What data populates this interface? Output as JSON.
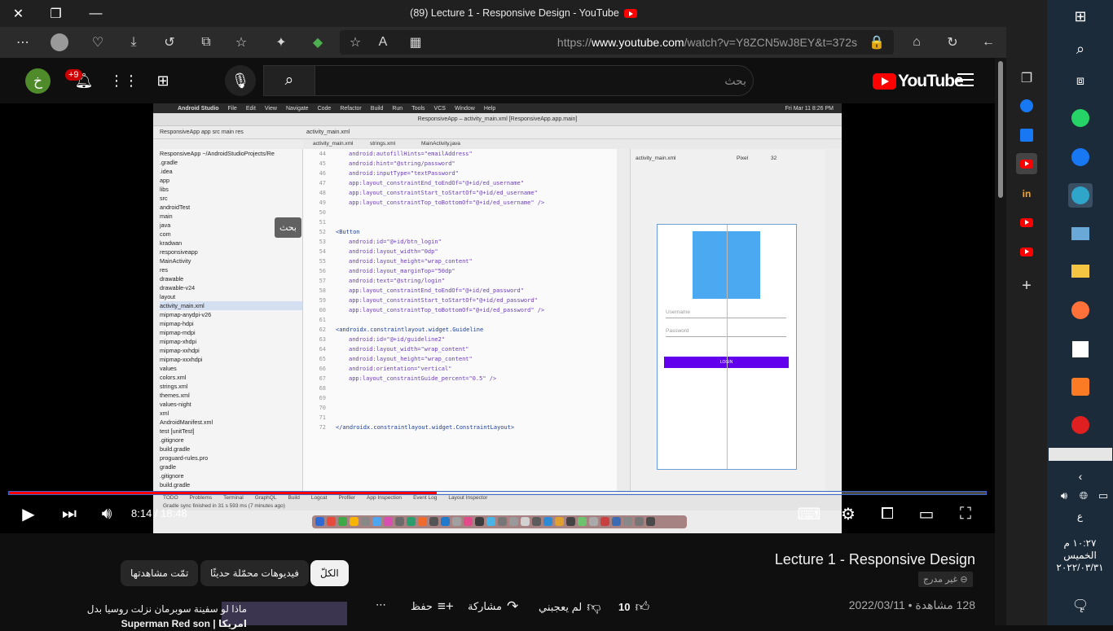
{
  "browser": {
    "tab_title": "(89) Lecture 1 - Responsive Design - YouTube",
    "url_prefix": "https://",
    "url_domain": "www.youtube.com",
    "url_rest": "/watch?v=Y8ZCN5wJ8EY&t=372s"
  },
  "youtube": {
    "logo_text": "YouTube",
    "search_placeholder": "بحث",
    "search_tooltip": "بحث",
    "avatar_initial": "خ",
    "notifications_count": "+9"
  },
  "player": {
    "time_current": "8:14",
    "time_separator": " / ",
    "time_total": "18:48",
    "progress_fraction": 0.438
  },
  "android_studio": {
    "menu": [
      "Android Studio",
      "File",
      "Edit",
      "View",
      "Navigate",
      "Code",
      "Refactor",
      "Build",
      "Run",
      "Tools",
      "VCS",
      "Window",
      "Help"
    ],
    "menu_clock": "Fri Mar 11  8:26 PM",
    "window_title": "ResponsiveApp – activity_main.xml [ResponsiveApp.app.main]",
    "breadcrumb": "ResponsiveApp  app  src  main  res",
    "tabs": [
      "activity_main.xml",
      "strings.xml",
      "MainActivity.java"
    ],
    "tree": [
      "ResponsiveApp ~/AndroidStudioProjects/Re",
      ".gradle",
      ".idea",
      "app",
      "libs",
      "src",
      "androidTest",
      "main",
      "java",
      "com",
      "kradwan",
      "responsiveapp",
      "MainActivity",
      "res",
      "drawable",
      "drawable-v24",
      "layout",
      "activity_main.xml",
      "mipmap-anydpi-v26",
      "mipmap-hdpi",
      "mipmap-mdpi",
      "mipmap-xhdpi",
      "mipmap-xxhdpi",
      "mipmap-xxxhdpi",
      "values",
      "colors.xml",
      "strings.xml",
      "themes.xml",
      "values-night",
      "xml",
      "AndroidManifest.xml",
      "test [unitTest]",
      ".gitignore",
      "build.gradle",
      "proguard-rules.pro",
      "gradle",
      ".gitignore",
      "build.gradle"
    ],
    "code": [
      {
        "n": "44",
        "t": "android:autofillHints=\"emailAddress\""
      },
      {
        "n": "45",
        "t": "android:hint=\"@string/password\""
      },
      {
        "n": "46",
        "t": "android:inputType=\"textPassword\""
      },
      {
        "n": "47",
        "t": "app:layout_constraintEnd_toEndOf=\"@+id/ed_username\""
      },
      {
        "n": "48",
        "t": "app:layout_constraintStart_toStartOf=\"@+id/ed_username\""
      },
      {
        "n": "49",
        "t": "app:layout_constraintTop_toBottomOf=\"@+id/ed_username\" />"
      },
      {
        "n": "50",
        "t": ""
      },
      {
        "n": "51",
        "t": ""
      },
      {
        "n": "52",
        "t": "<Button"
      },
      {
        "n": "53",
        "t": "android:id=\"@+id/btn_login\""
      },
      {
        "n": "54",
        "t": "android:layout_width=\"0dp\""
      },
      {
        "n": "55",
        "t": "android:layout_height=\"wrap_content\""
      },
      {
        "n": "56",
        "t": "android:layout_marginTop=\"50dp\""
      },
      {
        "n": "57",
        "t": "android:text=\"@string/login\""
      },
      {
        "n": "58",
        "t": "app:layout_constraintEnd_toEndOf=\"@+id/ed_password\""
      },
      {
        "n": "59",
        "t": "app:layout_constraintStart_toStartOf=\"@+id/ed_password\""
      },
      {
        "n": "60",
        "t": "app:layout_constraintTop_toBottomOf=\"@+id/ed_password\" />"
      },
      {
        "n": "61",
        "t": ""
      },
      {
        "n": "62",
        "t": "<androidx.constraintlayout.widget.Guideline"
      },
      {
        "n": "63",
        "t": "android:id=\"@+id/guideline2\""
      },
      {
        "n": "64",
        "t": "android:layout_width=\"wrap_content\""
      },
      {
        "n": "65",
        "t": "android:layout_height=\"wrap_content\""
      },
      {
        "n": "66",
        "t": "android:orientation=\"vertical\""
      },
      {
        "n": "67",
        "t": "app:layout_constraintGuide_percent=\"0.5\" />"
      },
      {
        "n": "68",
        "t": ""
      },
      {
        "n": "69",
        "t": ""
      },
      {
        "n": "70",
        "t": ""
      },
      {
        "n": "71",
        "t": ""
      },
      {
        "n": "72",
        "t": "</androidx.constraintlayout.widget.ConstraintLayout>"
      }
    ],
    "design_file": "activity_main.xml",
    "design_device": "Pixel",
    "design_api": "32",
    "preview_username": "Username",
    "preview_password": "Password",
    "preview_login": "LOGIN",
    "status_text": "Gradle sync finished in 31 s 593 ms (7 minutes ago)",
    "bottom_tabs": [
      "TODO",
      "Problems",
      "Terminal",
      "GraphQL",
      "Build",
      "Logcat",
      "Profiler",
      "App Inspection",
      "Event Log",
      "Layout Inspector"
    ]
  },
  "video": {
    "title": "Lecture 1 - Responsive Design",
    "unlisted": "غير مدرج",
    "views": "128 مشاهدة",
    "date": "2022/03/11",
    "likes": "10",
    "dislike_label": "لم يعجبني",
    "share_label": "مشاركة",
    "save_label": "حفظ"
  },
  "chips": {
    "all": "الكلّ",
    "recent": "فيديوهات محمّلة حديثًا",
    "watched": "تمّت مشاهدتها"
  },
  "recommendation": {
    "title_line1": "ماذا لو سفينة سوبرمان نزلت روسيا بدل",
    "title_line2": "امريكا | Superman Red son"
  },
  "taskbar": {
    "clock_time": "١٠:٢٧ م",
    "clock_day": "الخميس",
    "clock_date": "٢٠٢٢/٠٣/٣١",
    "lang": "ع",
    "notif_count": "٤"
  }
}
